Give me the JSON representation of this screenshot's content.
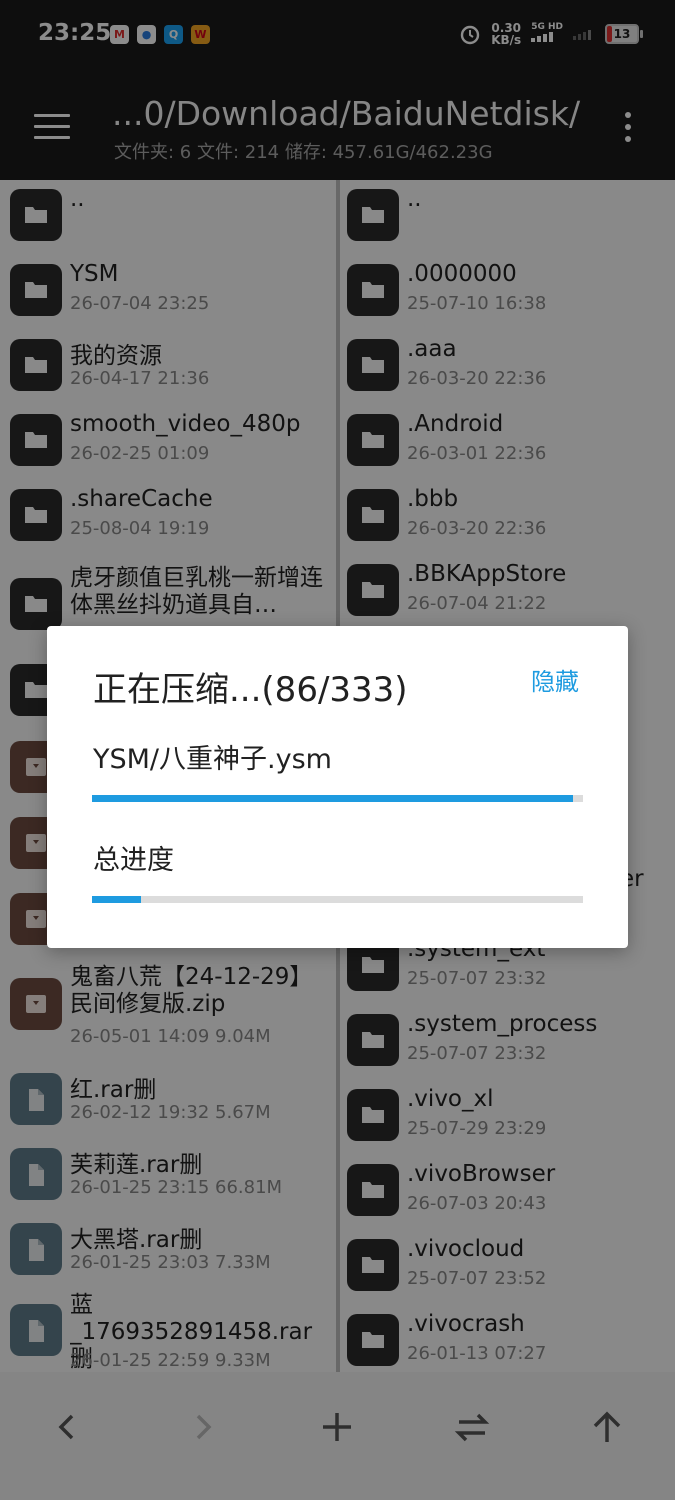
{
  "status": {
    "time": "23:25",
    "net_speed_top": "0.30",
    "net_speed_unit": "KB/s",
    "net_type": "5G HD",
    "battery": "13"
  },
  "header": {
    "path": "...0/Download/BaiduNetdisk/",
    "stats": "文件夹: 6  文件: 214  储存: 457.61G/462.23G"
  },
  "left_pane": [
    {
      "name": "..",
      "meta": "",
      "type": "folder"
    },
    {
      "name": "YSM",
      "meta": "26-07-04 23:25",
      "type": "folder"
    },
    {
      "name": "我的资源",
      "meta": "26-04-17 21:36",
      "type": "folder"
    },
    {
      "name": "smooth_video_480p",
      "meta": "26-02-25 01:09",
      "type": "folder"
    },
    {
      "name": ".shareCache",
      "meta": "25-08-04 19:19",
      "type": "folder"
    },
    {
      "name": "虎牙颜值巨乳桃一新增连体黑丝抖奶道具自…",
      "meta": "",
      "type": "folder"
    },
    {
      "name": "",
      "meta": "",
      "type": "folder"
    },
    {
      "name": "",
      "meta": "",
      "type": "archive"
    },
    {
      "name": "",
      "meta": "",
      "type": "archive"
    },
    {
      "name": "",
      "meta": "",
      "type": "archive"
    },
    {
      "name": "鬼畜八荒【24-12-29】民间修复版.zip",
      "meta": "26-05-01 14:09  9.04M",
      "type": "archive"
    },
    {
      "name": "红.rar删",
      "meta": "26-02-12 19:32  5.67M",
      "type": "file"
    },
    {
      "name": "芙莉莲.rar删",
      "meta": "26-01-25 23:15  66.81M",
      "type": "file"
    },
    {
      "name": "大黑塔.rar删",
      "meta": "26-01-25 23:03  7.33M",
      "type": "file"
    },
    {
      "name": "蓝_1769352891458.rar删",
      "meta": "26-01-25 22:59  9.33M",
      "type": "file"
    }
  ],
  "right_pane": [
    {
      "name": "..",
      "meta": "",
      "type": "folder"
    },
    {
      "name": ".0000000",
      "meta": "25-07-10 16:38",
      "type": "folder"
    },
    {
      "name": ".aaa",
      "meta": "26-03-20 22:36",
      "type": "folder"
    },
    {
      "name": ".Android",
      "meta": "26-03-01 22:36",
      "type": "folder"
    },
    {
      "name": ".bbb",
      "meta": "26-03-20 22:36",
      "type": "folder"
    },
    {
      "name": ".BBKAppStore",
      "meta": "26-07-04 21:22",
      "type": "folder"
    },
    {
      "name": "er",
      "meta": "",
      "type": "folder"
    },
    {
      "name": ".system_ext",
      "meta": "25-07-07 23:32",
      "type": "folder"
    },
    {
      "name": ".system_process",
      "meta": "25-07-07 23:32",
      "type": "folder"
    },
    {
      "name": ".vivo_xl",
      "meta": "25-07-29 23:29",
      "type": "folder"
    },
    {
      "name": ".vivoBrowser",
      "meta": "26-07-03 20:43",
      "type": "folder"
    },
    {
      "name": ".vivocloud",
      "meta": "25-07-07 23:52",
      "type": "folder"
    },
    {
      "name": ".vivocrash",
      "meta": "26-01-13 07:27",
      "type": "folder"
    }
  ],
  "dialog": {
    "title": "正在压缩...(86/333)",
    "hide_label": "隐藏",
    "current_file": "YSM/八重神子.ysm",
    "file_progress": 0.98,
    "total_label": "总进度",
    "total_progress": 0.1,
    "accent_color": "#1e9be0"
  },
  "bottom_bar": [
    "chevron-left-icon",
    "chevron-right-icon",
    "plus-icon",
    "swap-icon",
    "arrow-up-icon"
  ]
}
